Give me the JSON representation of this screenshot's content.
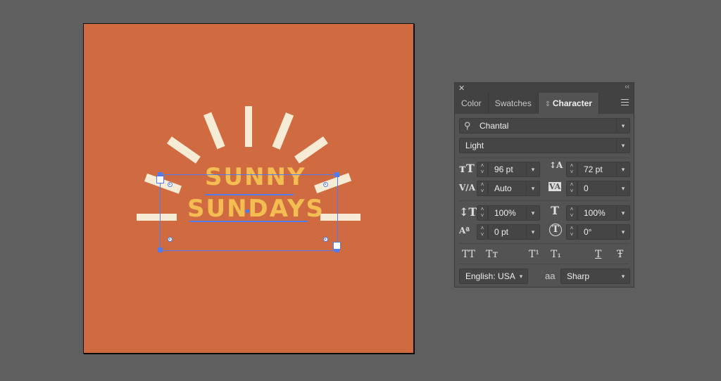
{
  "artboard": {
    "background_color": "#d06a41",
    "ray_color": "#f6ecd6",
    "text_color": "#f3bd51",
    "text_lines": [
      "SUNNY",
      "SUNDAYS"
    ]
  },
  "selection": {
    "color": "#4f7cf0"
  },
  "panel": {
    "close_icon": "close-icon",
    "collapse_label": "‹‹",
    "tabs": [
      {
        "label": "Color",
        "active": false
      },
      {
        "label": "Swatches",
        "active": false
      },
      {
        "label": "Character",
        "active": true
      }
    ],
    "font_family": "Chantal",
    "font_style": "Light",
    "font_size": "96 pt",
    "leading": "72 pt",
    "kerning": "Auto",
    "tracking": "0",
    "vertical_scale": "100%",
    "horizontal_scale": "100%",
    "baseline_shift": "0 pt",
    "character_rotation": "0°",
    "style_buttons": [
      "TT",
      "Tт",
      "T¹",
      "T₁",
      "T",
      "Ŧ"
    ],
    "language": "English: USA",
    "antialiasing_icon": "aa",
    "antialiasing": "Sharp"
  }
}
